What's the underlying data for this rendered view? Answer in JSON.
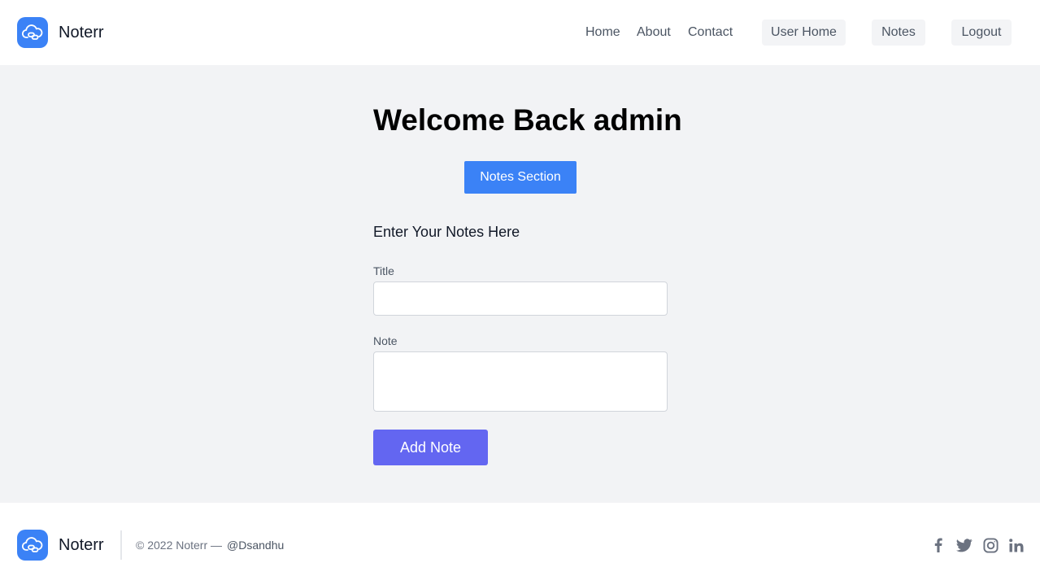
{
  "header": {
    "brand": "Noterr",
    "nav": {
      "home": "Home",
      "about": "About",
      "contact": "Contact",
      "user_home": "User Home",
      "notes": "Notes",
      "logout": "Logout"
    }
  },
  "main": {
    "welcome": "Welcome Back admin",
    "notes_section_button": "Notes Section",
    "form_heading": "Enter Your Notes Here",
    "title_label": "Title",
    "title_value": "",
    "note_label": "Note",
    "note_value": "",
    "add_button": "Add Note"
  },
  "footer": {
    "brand": "Noterr",
    "copyright": "© 2022 Noterr —",
    "handle": "@Dsandhu",
    "social_icons": [
      "facebook-icon",
      "twitter-icon",
      "instagram-icon",
      "linkedin-icon"
    ]
  },
  "colors": {
    "brand_blue": "#3b82f6",
    "indigo_button": "#6366f1",
    "page_bg": "#f2f3f5",
    "nav_button_bg": "#f3f4f6"
  }
}
